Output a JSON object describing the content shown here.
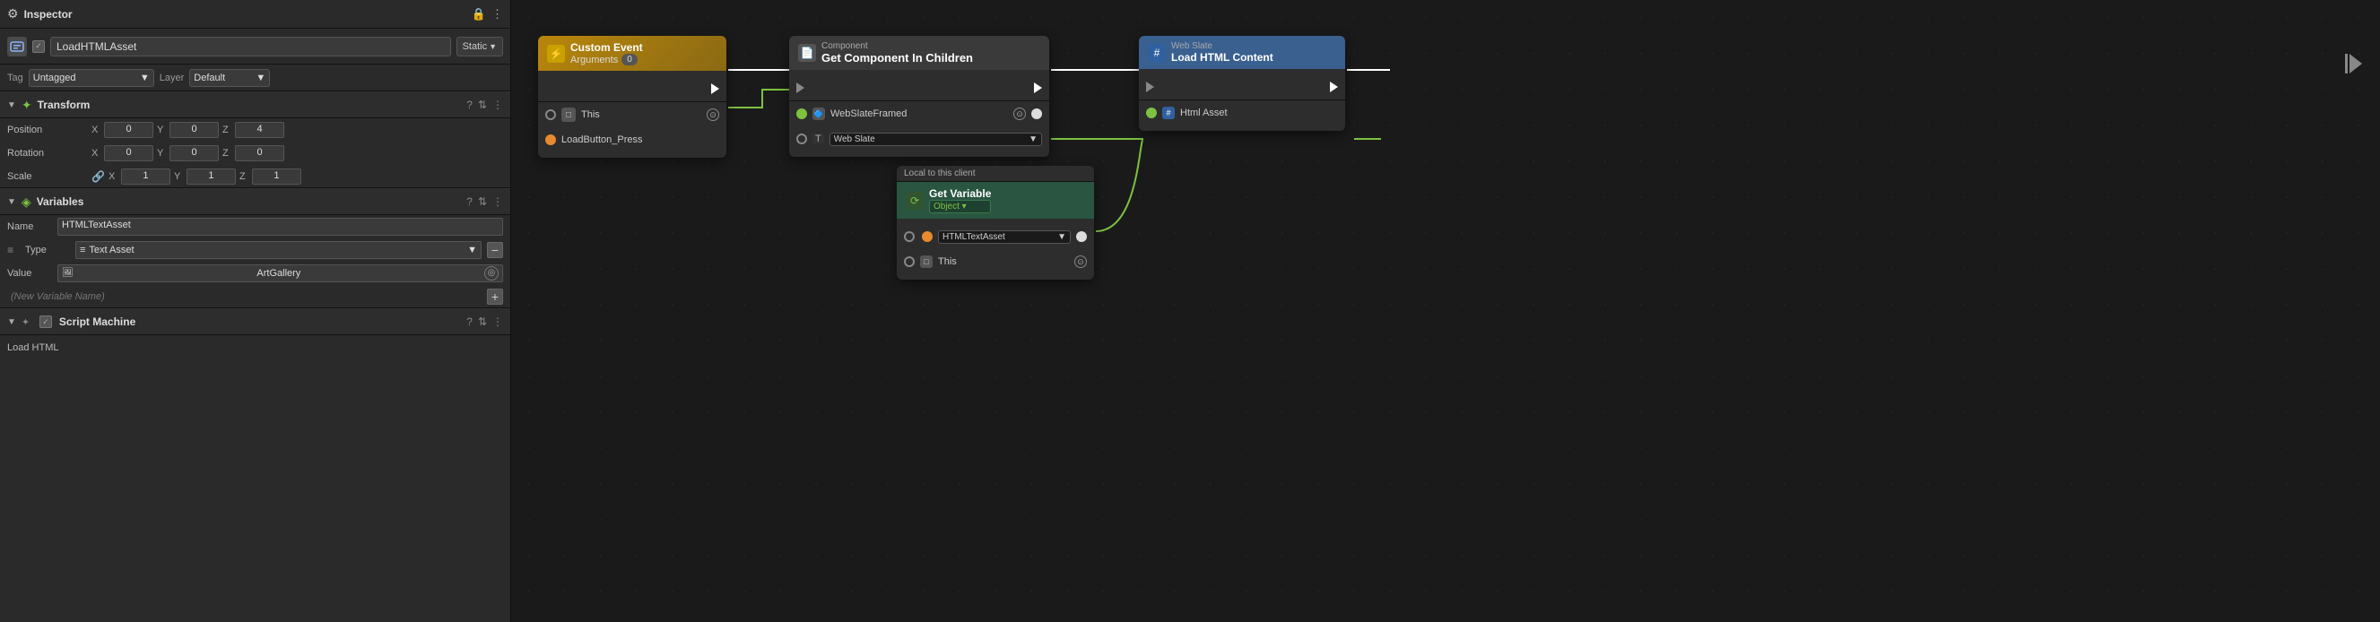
{
  "inspector": {
    "title": "Inspector",
    "lock_icon": "🔒",
    "dots_icon": "⋮",
    "object": {
      "name": "LoadHTMLAsset",
      "checkbox_checked": true,
      "static_label": "Static"
    },
    "tag": {
      "label": "Tag",
      "value": "Untagged"
    },
    "layer": {
      "label": "Layer",
      "value": "Default"
    },
    "transform": {
      "title": "Transform",
      "position_label": "Position",
      "position": {
        "x": "0",
        "y": "0",
        "z": "4"
      },
      "rotation_label": "Rotation",
      "rotation": {
        "x": "0",
        "y": "0",
        "z": "0"
      },
      "scale_label": "Scale",
      "scale": {
        "x": "1",
        "y": "1",
        "z": "1"
      }
    },
    "variables": {
      "title": "Variables",
      "name_label": "Name",
      "name_value": "HTMLTextAsset",
      "type_label": "Type",
      "type_icon": "≡",
      "type_value": "Text Asset",
      "value_label": "Value",
      "value_value": "ArtGallery",
      "new_var_placeholder": "(New Variable Name)",
      "minus_label": "−",
      "plus_label": "+"
    },
    "script_machine": {
      "title": "Script Machine",
      "script_name": "Load HTML"
    }
  },
  "graph": {
    "custom_event_node": {
      "header_title": "Custom Event",
      "header_subtitle": "Arguments",
      "badge": "0",
      "port_exec": "►",
      "row1_label": "This",
      "row2_label": "LoadButton_Press"
    },
    "component_node": {
      "header_label1": "Component",
      "header_label2": "Get Component In Children",
      "port_exec_in": "►",
      "port_exec_out": "►",
      "row1_label": "WebSlateFramed",
      "row1_right": "",
      "row2_label": "T",
      "row2_value": "Web Slate",
      "return_label": ""
    },
    "webslate_node": {
      "header_title": "Web Slate",
      "header_subtitle": "Load HTML Content",
      "port_exec_in": "►",
      "port_exec_out": "►",
      "row1_label": "Html Asset",
      "end_arrow": "▶|"
    },
    "getvariable_node": {
      "badge_label": "Local to this client",
      "header_title": "Get Variable",
      "header_dropdown": "Object ▾",
      "row1_label": "HTMLTextAsset",
      "row1_dropdown": "▾",
      "row2_label": "This"
    }
  }
}
